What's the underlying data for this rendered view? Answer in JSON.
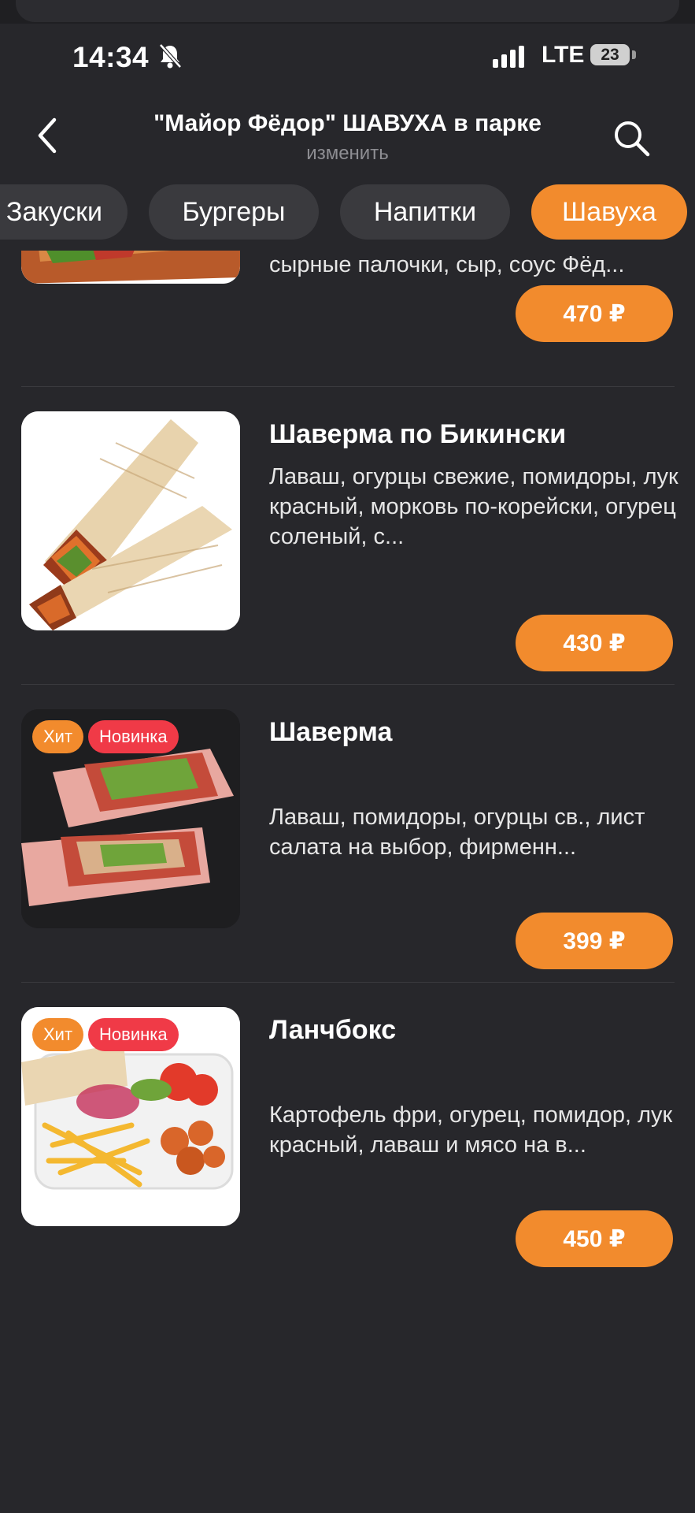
{
  "status_bar": {
    "time": "14:34",
    "network": "LTE",
    "battery": "23"
  },
  "header": {
    "title": "\"Майор Фёдор\" ШАВУХА в парке",
    "subtitle": "изменить",
    "back_icon": "chevron-left-icon",
    "search_icon": "search-icon"
  },
  "categories": [
    {
      "label": "Закуски",
      "active": false
    },
    {
      "label": "Бургеры",
      "active": false
    },
    {
      "label": "Напитки",
      "active": false
    },
    {
      "label": "Шавуха",
      "active": true
    }
  ],
  "items": [
    {
      "name": "",
      "description": "сырные палочки, сыр, соус Фёд...",
      "price": "470 ₽",
      "badges": []
    },
    {
      "name": "Шаверма по Бикински",
      "description": "Лаваш, огурцы свежие, помидоры, лук красный, морковь по-корейски, огурец соленый, с...",
      "price": "430 ₽",
      "badges": []
    },
    {
      "name": "Шаверма",
      "description": "Лаваш, помидоры, огурцы св., лист салата на выбор, фирменн...",
      "price": "399 ₽",
      "badges": [
        "Хит",
        "Новинка"
      ]
    },
    {
      "name": "Ланчбокс",
      "description": "Картофель фри, огурец, помидор, лук красный, лаваш и мясо на в...",
      "price": "450 ₽",
      "badges": [
        "Хит",
        "Новинка"
      ]
    }
  ],
  "colors": {
    "background": "#27272b",
    "accent": "#f28b2d",
    "badge_new": "#f03a47",
    "chip": "#3a3a3e"
  }
}
